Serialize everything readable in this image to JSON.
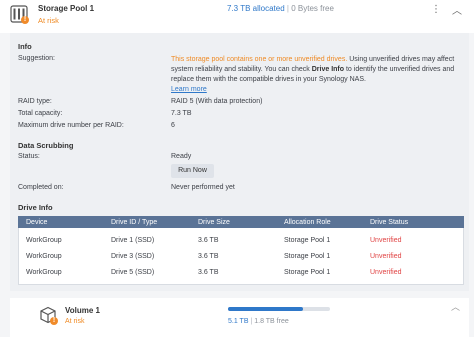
{
  "pool": {
    "title": "Storage Pool 1",
    "status": "At risk",
    "allocated": "7.3 TB allocated",
    "separator": "|",
    "free": "0 Bytes free",
    "menu": "⋮",
    "collapse": "︿"
  },
  "info": {
    "section": "Info",
    "suggestion_label": "Suggestion:",
    "suggestion_warning": "This storage pool contains one or more unverified drives.",
    "suggestion_text1": "Using unverified drives may affect system reliability and stability. You can check",
    "suggestion_bold": "Drive Info",
    "suggestion_text2": "to identify the unverified drives and replace them with the compatible drives in your Synology NAS.",
    "learn_more": "Learn more",
    "raid_label": "RAID type:",
    "raid_value": "RAID 5 (With data protection)",
    "capacity_label": "Total capacity:",
    "capacity_value": "7.3 TB",
    "max_label": "Maximum drive number per RAID:",
    "max_value": "6"
  },
  "scrub": {
    "section": "Data Scrubbing",
    "status_label": "Status:",
    "status_value": "Ready",
    "run_now": "Run Now",
    "completed_label": "Completed on:",
    "completed_value": "Never performed yet"
  },
  "drives": {
    "section": "Drive Info",
    "columns": [
      "Device",
      "Drive ID / Type",
      "Drive Size",
      "Allocation Role",
      "Drive Status"
    ],
    "rows": [
      [
        "WorkGroup",
        "Drive 1 (SSD)",
        "3.6 TB",
        "Storage Pool 1",
        "Unverified"
      ],
      [
        "WorkGroup",
        "Drive 3 (SSD)",
        "3.6 TB",
        "Storage Pool 1",
        "Unverified"
      ],
      [
        "WorkGroup",
        "Drive 5 (SSD)",
        "3.6 TB",
        "Storage Pool 1",
        "Unverified"
      ]
    ]
  },
  "volume": {
    "title": "Volume 1",
    "status": "At risk",
    "used": "5.1 TB",
    "separator": "|",
    "free": "1.8 TB free",
    "usage_fraction": 0.74,
    "collapse": "︿"
  },
  "colors": {
    "accent": "#2f78c9",
    "warning": "#ef8a24",
    "danger": "#e04343",
    "table_header": "#5a7396"
  }
}
